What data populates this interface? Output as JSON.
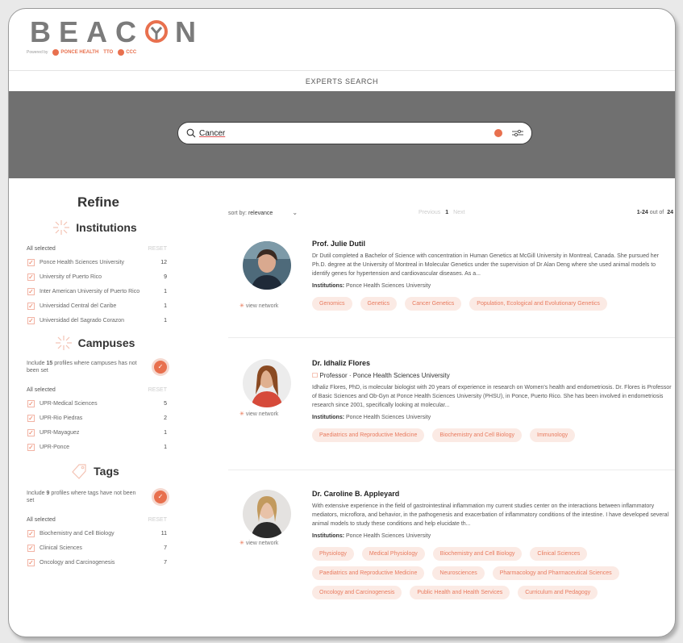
{
  "brand": {
    "logo_text_left": "BEAC",
    "logo_text_right": "N",
    "powered_by": "Powered by",
    "partners": [
      "PONCE HEALTH",
      "TTO",
      "CCC"
    ]
  },
  "subbar": {
    "title": "EXPERTS SEARCH"
  },
  "search": {
    "value": "Cancer"
  },
  "sidebar": {
    "refine_title": "Refine",
    "institutions": {
      "title": "Institutions",
      "all_selected": "All selected",
      "reset": "RESET",
      "items": [
        {
          "label": "Ponce Health Sciences University",
          "count": "12"
        },
        {
          "label": "University of Puerto Rico",
          "count": "9"
        },
        {
          "label": "Inter American University of Puerto Rico",
          "count": "1"
        },
        {
          "label": "Universidad Central del Caribe",
          "count": "1"
        },
        {
          "label": "Universidad del Sagrado Corazon",
          "count": "1"
        }
      ]
    },
    "campuses": {
      "title": "Campuses",
      "include_pre": "Include ",
      "include_num": "15",
      "include_post": " profiles where campuses has not been set",
      "all_selected": "All selected",
      "reset": "RESET",
      "items": [
        {
          "label": "UPR-Medical Sciences",
          "count": "5"
        },
        {
          "label": "UPR-Rio Piedras",
          "count": "2"
        },
        {
          "label": "UPR-Mayaguez",
          "count": "1"
        },
        {
          "label": "UPR-Ponce",
          "count": "1"
        }
      ]
    },
    "tags": {
      "title": "Tags",
      "include_pre": "Include ",
      "include_num": "9",
      "include_post": " profiles where tags have not been set",
      "all_selected": "All selected",
      "reset": "RESET",
      "items": [
        {
          "label": "Biochemistry and Cell Biology",
          "count": "11"
        },
        {
          "label": "Clinical Sciences",
          "count": "7"
        },
        {
          "label": "Oncology and Carcinogenesis",
          "count": "7"
        }
      ]
    }
  },
  "results": {
    "sort_label": "sort by:",
    "sort_value": "relevance",
    "pager_prev": "Previous",
    "pager_current": "1",
    "pager_next": "Next",
    "count_range": "1-24",
    "count_suffix": " out of ",
    "count_total": "24",
    "view_network": "view network",
    "institutions_label": "Institutions:",
    "experts": [
      {
        "name": "Prof. Julie Dutil",
        "role": "",
        "bio": "Dr Dutil completed a Bachelor of Science with concentration in Human Genetics at McGill University in Montreal, Canada. She pursued her Ph.D. degree at the University of Montreal in Molecular Genetics under the supervision of Dr Alan Deng where she used animal models to identify genes for hypertension and cardiovascular diseases. As a...",
        "institution": "Ponce Health Sciences University",
        "tags": [
          "Genomics",
          "Genetics",
          "Cancer Genetics",
          "Population, Ecological and Evolutionary Genetics"
        ]
      },
      {
        "name": "Dr. Idhaliz Flores",
        "role": "Professor · Ponce Health Sciences University",
        "bio": "Idhaliz Flores, PhD, is molecular biologist with 20 years of experience in research on Women's health and endometriosis. Dr. Flores is Professor of Basic Sciences and Ob-Gyn at Ponce Health Sciences University (PHSU), in Ponce, Puerto Rico. She has been involved in endometriosis research since 2001, specifically looking at molecular...",
        "institution": "Ponce Health Sciences University",
        "tags": [
          "Paediatrics and Reproductive Medicine",
          "Biochemistry and Cell Biology",
          "Immunology"
        ]
      },
      {
        "name": "Dr. Caroline B. Appleyard",
        "role": "",
        "bio": "With extensive experience in the field of gastrointestinal inflammation my current studies center on the interactions between inflammatory mediators, microflora, and behavior, in the pathogenesis and exacerbation of inflammatory conditions of the intestine. I have developed several animal models to study these conditions and help elucidate th...",
        "institution": "Ponce Health Sciences University",
        "tags": [
          "Physiology",
          "Medical Physiology",
          "Biochemistry and Cell Biology",
          "Clinical Sciences",
          "Paediatrics and Reproductive Medicine",
          "Neurosciences",
          "Pharmacology and Pharmaceutical Sciences",
          "Oncology and Carcinogenesis",
          "Public Health and Health Services",
          "Curriculum and Pedagogy"
        ]
      }
    ]
  },
  "colors": {
    "accent": "#e8704e",
    "band": "#707070",
    "tag_bg": "#fbeae4"
  },
  "icons": [
    "search-icon",
    "clear-icon",
    "filter-icon",
    "sunburst-icon",
    "tag-icon",
    "network-icon"
  ]
}
